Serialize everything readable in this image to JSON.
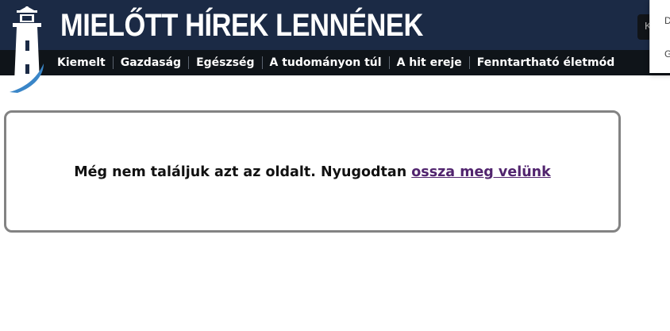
{
  "header": {
    "site_title": "MIELŐTT HÍREK LENNÉNEK",
    "background_color": "#1b2a45",
    "logo_icon": "lighthouse-icon",
    "search_button_label": "K"
  },
  "nav": {
    "background_color": "#0f1419",
    "items": [
      {
        "label": "Kiemelt"
      },
      {
        "label": "Gazdaság"
      },
      {
        "label": "Egészség"
      },
      {
        "label": "A tudományon túl"
      },
      {
        "label": "A hit ereje"
      },
      {
        "label": "Fenntartható életmód"
      }
    ]
  },
  "dropdown": {
    "items": [
      {
        "label": "D"
      },
      {
        "label": "G"
      }
    ]
  },
  "main": {
    "message_text": "Még nem találjuk azt az oldalt. Nyugodtan",
    "message_link_text": "ossza meg velünk",
    "link_color": "#51246e"
  }
}
